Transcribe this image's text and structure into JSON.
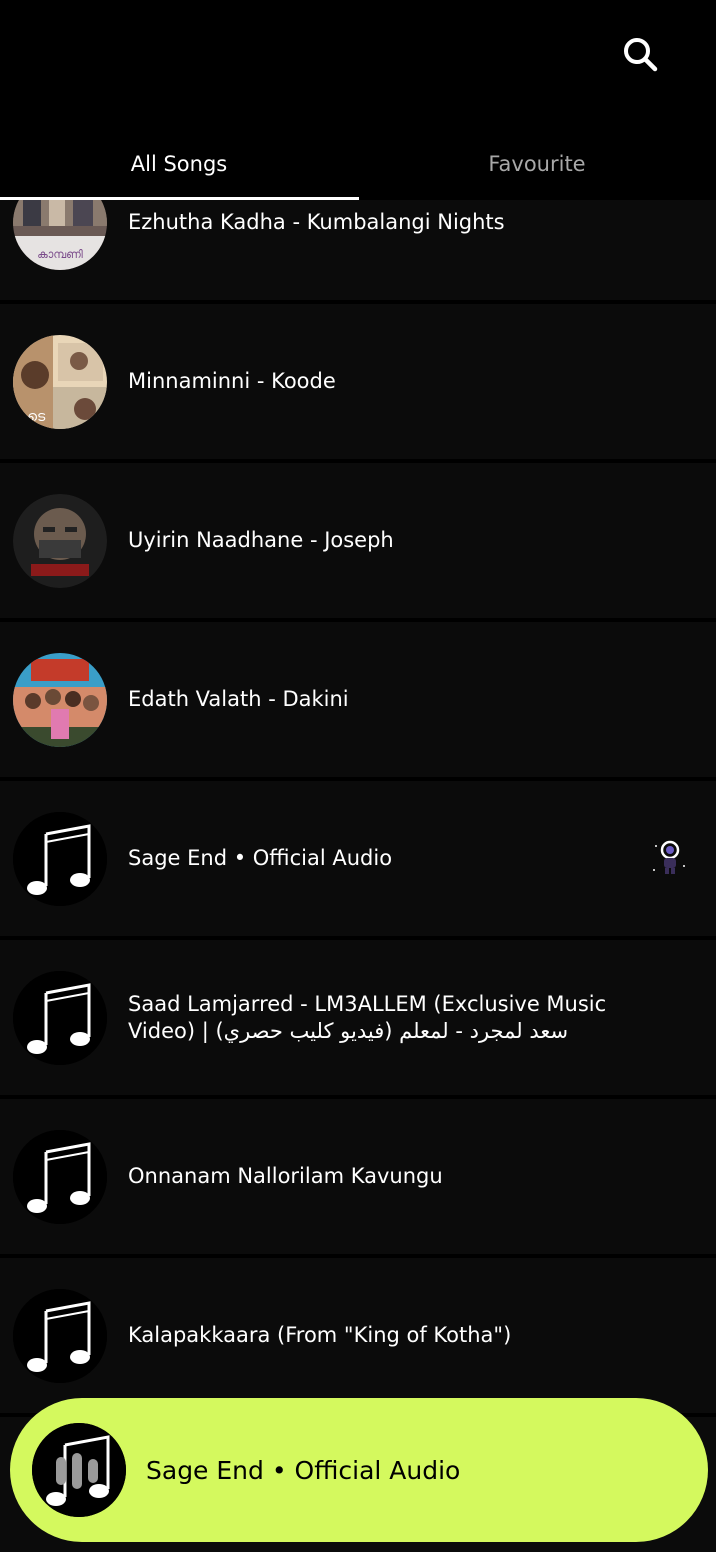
{
  "header": {
    "search_icon": "search-icon"
  },
  "tabs": [
    {
      "label": "All Songs",
      "active": true
    },
    {
      "label": "Favourite",
      "active": false
    }
  ],
  "songs": [
    {
      "title": "Ezhutha Kadha - Kumbalangi Nights",
      "thumb": "album-art"
    },
    {
      "title": "Minnaminni - Koode",
      "thumb": "album-art"
    },
    {
      "title": "Uyirin Naadhane - Joseph",
      "thumb": "album-art"
    },
    {
      "title": "Edath Valath - Dakini",
      "thumb": "album-art"
    },
    {
      "title": "Sage End • Official Audio",
      "thumb": "music-note-icon",
      "playing_icon": "astronaut-icon"
    },
    {
      "title": "Saad Lamjarred - LM3ALLEM (Exclusive Music\nVideo) |  سعد لمجرد - لمعلم (فيديو كليب حصري)",
      "thumb": "music-note-icon"
    },
    {
      "title": "Onnanam Nallorilam Kavungu",
      "thumb": "music-note-icon"
    },
    {
      "title": "Kalapakkaara (From \"King of Kotha\")",
      "thumb": "music-note-icon"
    }
  ],
  "now_playing": {
    "title": "Sage End • Official Audio",
    "thumb": "music-note-icon",
    "overlay_icon": "equalizer-icon"
  },
  "colors": {
    "background": "#000000",
    "row": "#0b0b0b",
    "player_bg": "#d4f95e",
    "tab_inactive": "#a8a8a8"
  }
}
